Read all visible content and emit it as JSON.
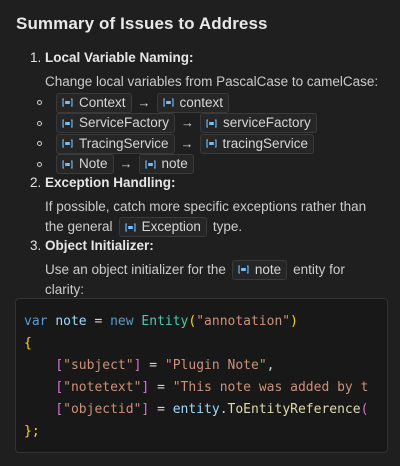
{
  "title": "Summary of Issues to Address",
  "items": [
    {
      "number": "1.",
      "heading": "Local Variable Naming:",
      "description": "Change local variables from PascalCase to camelCase:",
      "renames": [
        {
          "from": "Context",
          "to": "context"
        },
        {
          "from": "ServiceFactory",
          "to": "serviceFactory"
        },
        {
          "from": "TracingService",
          "to": "tracingService"
        },
        {
          "from": "Note",
          "to": "note"
        }
      ],
      "arrow": "→"
    },
    {
      "number": "2.",
      "heading": "Exception Handling:",
      "desc_line1": "If possible, catch more specific exceptions rather than",
      "desc_pre": "the general",
      "chip": "Exception",
      "desc_post": "type."
    },
    {
      "number": "3.",
      "heading": "Object Initializer:",
      "desc_pre": "Use an object initializer for the",
      "chip": "note",
      "desc_post": "entity for",
      "desc_line2": "clarity:"
    }
  ],
  "code": {
    "l1": {
      "kw1": "var",
      "v": "note",
      "eq": "=",
      "kw2": "new",
      "cls": "Entity",
      "open": "(",
      "str": "\"annotation\"",
      "close": ")"
    },
    "l2": {
      "brace": "{"
    },
    "l3": {
      "ob": "[",
      "key": "\"subject\"",
      "cb": "]",
      "eq": "=",
      "val": "\"Plugin Note\"",
      "comma": ","
    },
    "l4": {
      "ob": "[",
      "key": "\"notetext\"",
      "cb": "]",
      "eq": "=",
      "val": "\"This note was added by t"
    },
    "l5": {
      "ob": "[",
      "key": "\"objectid\"",
      "cb": "]",
      "eq": "=",
      "obj": "entity",
      "dot": ".",
      "fn": "ToEntityReference",
      "paren": "("
    },
    "l6": {
      "brace": "};"
    }
  },
  "icons": {
    "chip_icon": "symbol-variable-icon"
  },
  "colors": {
    "background": "#1f1f1f",
    "chip_icon": "#75beff",
    "keyword": "#569cd6",
    "string": "#ce9178",
    "type": "#4ec9b0"
  }
}
